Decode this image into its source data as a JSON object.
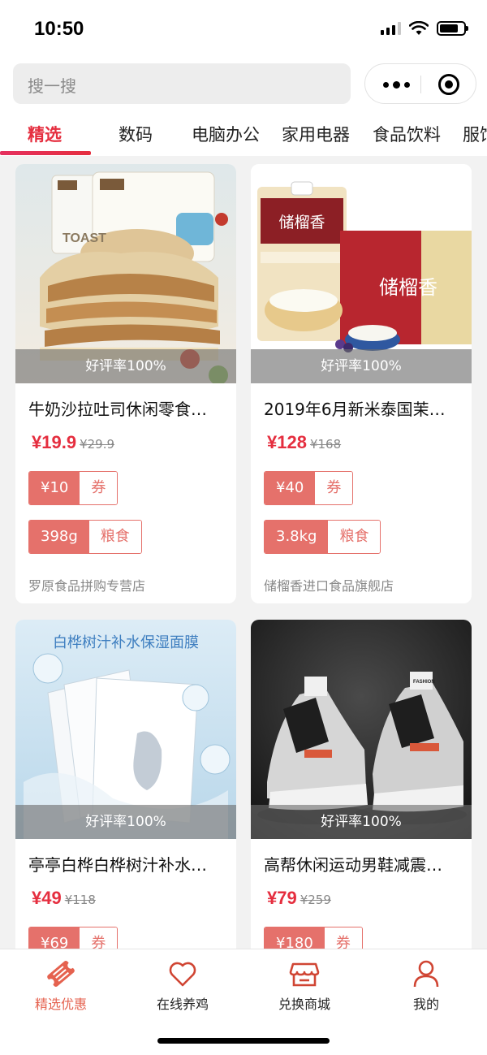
{
  "status_bar": {
    "time": "10:50"
  },
  "search": {
    "placeholder": "搜一搜"
  },
  "tabs": [
    {
      "label": "精选",
      "active": true
    },
    {
      "label": "数码"
    },
    {
      "label": "电脑办公"
    },
    {
      "label": "家用电器"
    },
    {
      "label": "食品饮料"
    },
    {
      "label": "服饰"
    }
  ],
  "products": [
    {
      "title": "牛奶沙拉吐司休闲零食…",
      "rating": "好评率100%",
      "price": "¥19.9",
      "old_price": "¥29.9",
      "coupon_value": "¥10",
      "coupon_label": "券",
      "weight": "398g",
      "category": "粮食",
      "shop": "罗原食品拼购专营店",
      "image_text": "TOAST"
    },
    {
      "title": "2019年6月新米泰国茉…",
      "rating": "好评率100%",
      "price": "¥128",
      "old_price": "¥168",
      "coupon_value": "¥40",
      "coupon_label": "券",
      "weight": "3.8kg",
      "category": "粮食",
      "shop": "储榴香进口食品旗舰店",
      "image_text": "储榴香"
    },
    {
      "title": "亭亭白桦白桦树汁补水…",
      "rating": "好评率100%",
      "price": "¥49",
      "old_price": "¥118",
      "coupon_value": "¥69",
      "coupon_label": "券",
      "image_text": "白桦树汁补水保湿面膜"
    },
    {
      "title": "高帮休闲运动男鞋减震…",
      "rating": "好评率100%",
      "price": "¥79",
      "old_price": "¥259",
      "coupon_value": "¥180",
      "coupon_label": "券",
      "image_text": "FASHION"
    }
  ],
  "bottom_nav": [
    {
      "label": "精选优惠",
      "icon": "ticket-icon",
      "active": true
    },
    {
      "label": "在线养鸡",
      "icon": "heart-icon"
    },
    {
      "label": "兑换商城",
      "icon": "store-icon"
    },
    {
      "label": "我的",
      "icon": "person-icon"
    }
  ],
  "colors": {
    "accent": "#e52e3f",
    "tag": "#e5716b"
  }
}
